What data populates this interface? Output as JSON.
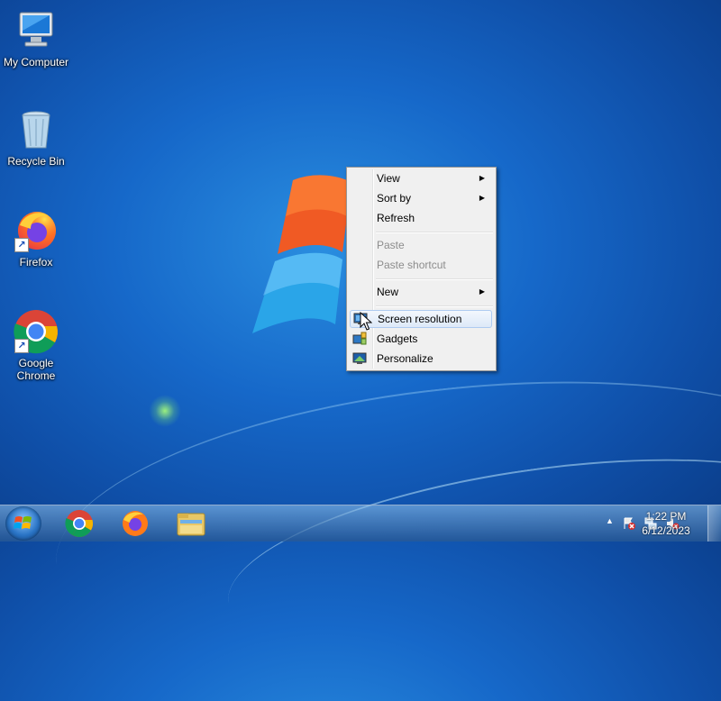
{
  "desktop": {
    "icons": [
      {
        "label": "My Computer",
        "icon": "computer-icon"
      },
      {
        "label": "Recycle Bin",
        "icon": "recycle-bin-icon"
      },
      {
        "label": "Firefox",
        "icon": "firefox-icon"
      },
      {
        "label": "Google Chrome",
        "icon": "chrome-icon"
      }
    ]
  },
  "context_menu": {
    "items": [
      {
        "label": "View",
        "submenu": true
      },
      {
        "label": "Sort by",
        "submenu": true
      },
      {
        "label": "Refresh"
      },
      {
        "label": "Paste",
        "disabled": true
      },
      {
        "label": "Paste shortcut",
        "disabled": true
      },
      {
        "label": "New",
        "submenu": true
      },
      {
        "label": "Screen resolution",
        "icon": "screen-resolution-icon",
        "highlighted": true
      },
      {
        "label": "Gadgets",
        "icon": "gadgets-icon"
      },
      {
        "label": "Personalize",
        "icon": "personalize-icon"
      }
    ],
    "submenu_arrow": "▶"
  },
  "taskbar": {
    "pinned": [
      {
        "name": "Google Chrome",
        "icon": "chrome-icon"
      },
      {
        "name": "Firefox",
        "icon": "firefox-icon"
      },
      {
        "name": "Windows Explorer",
        "icon": "folder-icon"
      }
    ],
    "tray": {
      "show_hidden_glyph": "▲",
      "icons": [
        "action-center-warning-icon",
        "network-icon",
        "volume-muted-icon"
      ]
    },
    "clock": {
      "time": "1:22 PM",
      "date": "6/12/2023"
    }
  },
  "colors": {
    "desktop_bg": "#1668c9",
    "menu_bg": "#f0f0f0",
    "menu_highlight": "#dde9f8"
  }
}
